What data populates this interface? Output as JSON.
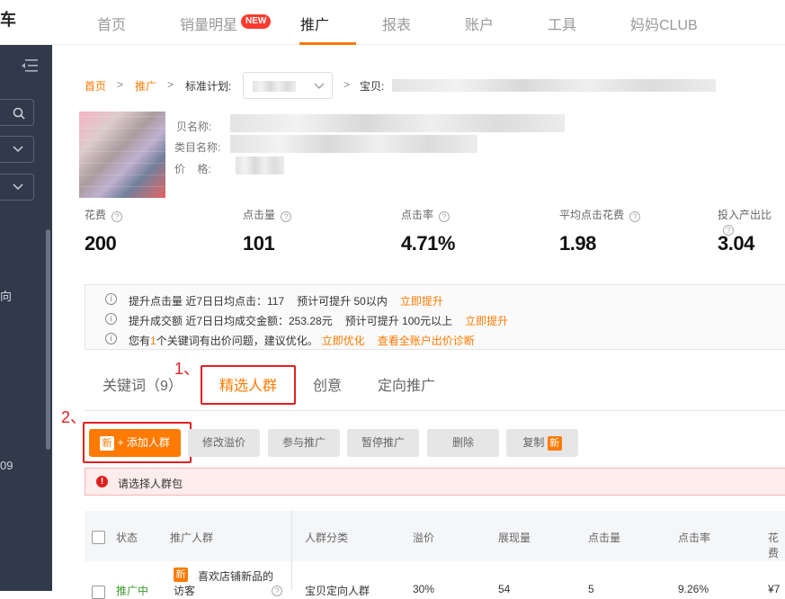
{
  "topnav": {
    "brand": "车",
    "items": [
      "首页",
      "销量明星",
      "推广",
      "报表",
      "账户",
      "工具",
      "妈妈CLUB"
    ],
    "new_badge": "NEW"
  },
  "sidebar": {
    "text_1": "向",
    "text_2": "09"
  },
  "breadcrumb": {
    "home": "首页",
    "sep": ">",
    "promo": "推广",
    "plan_label": "标准计划:",
    "item_label": "宝贝:"
  },
  "product": {
    "name_label": "贝名称:",
    "category_label": "类目名称:",
    "price_label": "价    格:"
  },
  "metrics": [
    {
      "label": "花费",
      "value": "200"
    },
    {
      "label": "点击量",
      "value": "101"
    },
    {
      "label": "点击率",
      "value": "4.71%"
    },
    {
      "label": "平均点击花费",
      "value": "1.98"
    },
    {
      "label": "投入产出比",
      "value": "3.04"
    }
  ],
  "tips": {
    "row1": {
      "text": "提升点击量 近7日日均点击：117",
      "extra": "预计可提升 50以内",
      "link": "立即提升"
    },
    "row2": {
      "text": "提升成交额 近7日日均成交金额：253.28元",
      "extra": "预计可提升 100元以上",
      "link": "立即提升"
    },
    "row3": {
      "pre": "您有",
      "count": "1",
      "post": "个关键词有出价问题，建议优化。",
      "link1": "立即优化",
      "link2": "查看全账户出价诊断"
    }
  },
  "tabs": {
    "keywords": "关键词（9）",
    "crowd": "精选人群",
    "creative": "创意",
    "targeting": "定向推广"
  },
  "annotations": {
    "one": "1、",
    "two": "2、"
  },
  "toolbar": {
    "new_badge": "新",
    "add_crowd": "+ 添加人群",
    "modify_premium": "修改溢价",
    "join_promo": "参与推广",
    "pause_promo": "暂停推广",
    "delete": "删除",
    "copy": "复制",
    "copy_badge": "新"
  },
  "alert": {
    "icon": "!",
    "text": "请选择人群包"
  },
  "table": {
    "headers": [
      "状态",
      "推广人群",
      "人群分类",
      "溢价",
      "展现量",
      "点击量",
      "点击率",
      "花费"
    ],
    "row1": {
      "status": "推广中",
      "new_badge": "新",
      "crowd": "喜欢店铺新品的",
      "crowd_2": "访客",
      "category": "宝贝定向人群",
      "premium": "30%",
      "impressions": "54",
      "clicks": "5",
      "ctr": "9.26%",
      "cost": "¥7"
    }
  },
  "colors": {
    "accent": "#ff7a00",
    "sidebar": "#313a4a",
    "alert_red": "#e02020"
  }
}
